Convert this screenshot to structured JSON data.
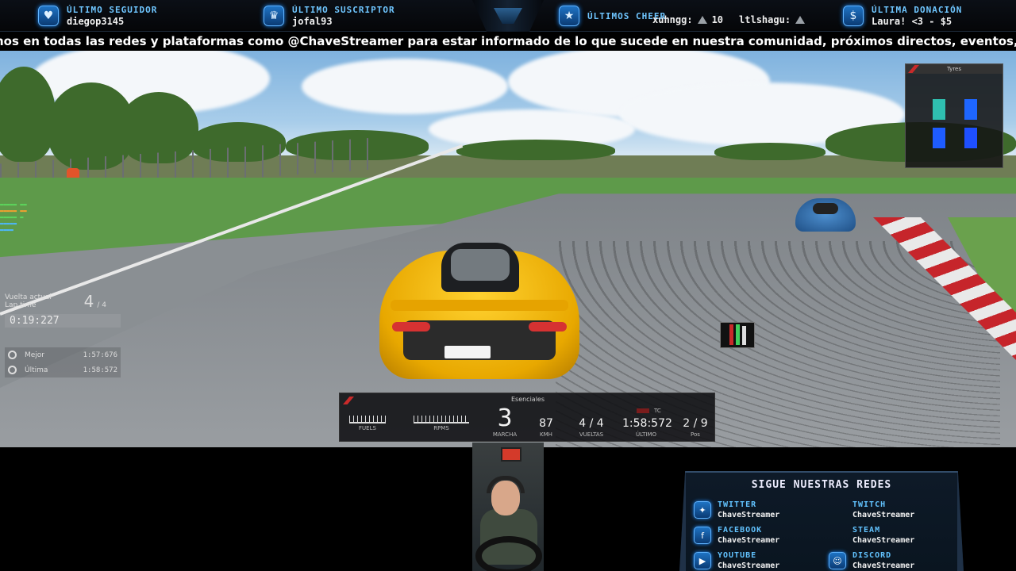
{
  "alerts": {
    "seguidor": {
      "label": "ÚLTIMO SEGUIDOR",
      "value": "diegop3145"
    },
    "suscriptor": {
      "label": "ÚLTIMO SUSCRIPTOR",
      "value": "jofal93"
    },
    "cheer": {
      "label": "ÚLTIMOS CHEER",
      "user1": "xuhngg:",
      "amount1": "10",
      "user2": "ltlshagu:"
    },
    "donacion": {
      "label": "ÚLTIMA DONACIÓN",
      "value": "Laura! <3 - $5"
    }
  },
  "ticker": {
    "text": "nos en todas las redes y plataformas como @ChaveStreamer para estar informado de lo que sucede en nuestra comunidad, próximos directos, eventos, sorteos y más!"
  },
  "hud": {
    "tyres_title": "Tyres",
    "lap": {
      "label": "Vuelta actual",
      "sublabel": "Lap time",
      "current": "4",
      "total": "/ 4",
      "time": "0:19:227"
    },
    "best": {
      "label": "Mejor",
      "value": "1:57:676"
    },
    "last": {
      "label": "Última",
      "value": "1:58:572"
    },
    "dash": {
      "title": "Esenciales",
      "tc": "TC",
      "fuel_label": "FUELS",
      "rpm_label": "RPMS",
      "gear": "3",
      "gear_label": "MARCHA",
      "speed": "87",
      "speed_label": "KMH",
      "laps": "4 / 4",
      "laps_label": "VUELTAS",
      "last": "1:58:572",
      "last_label": "ÚLTIMO",
      "pos": "2 / 9",
      "pos_label": "Pos"
    }
  },
  "socials": {
    "title": "SIGUE NUESTRAS REDES",
    "items": [
      {
        "name": "TWITTER",
        "handle": "ChaveStreamer"
      },
      {
        "name": "TWITCH",
        "handle": "ChaveStreamer"
      },
      {
        "name": "FACEBOOK",
        "handle": "ChaveStreamer"
      },
      {
        "name": "STEAM",
        "handle": "ChaveStreamer"
      },
      {
        "name": "YOUTUBE",
        "handle": "ChaveStreamer"
      },
      {
        "name": "DISCORD",
        "handle": "ChaveStreamer"
      }
    ]
  },
  "colors": {
    "accent": "#6fc6ff",
    "kerb_red": "#c6252b",
    "car_yellow": "#ffd230"
  }
}
